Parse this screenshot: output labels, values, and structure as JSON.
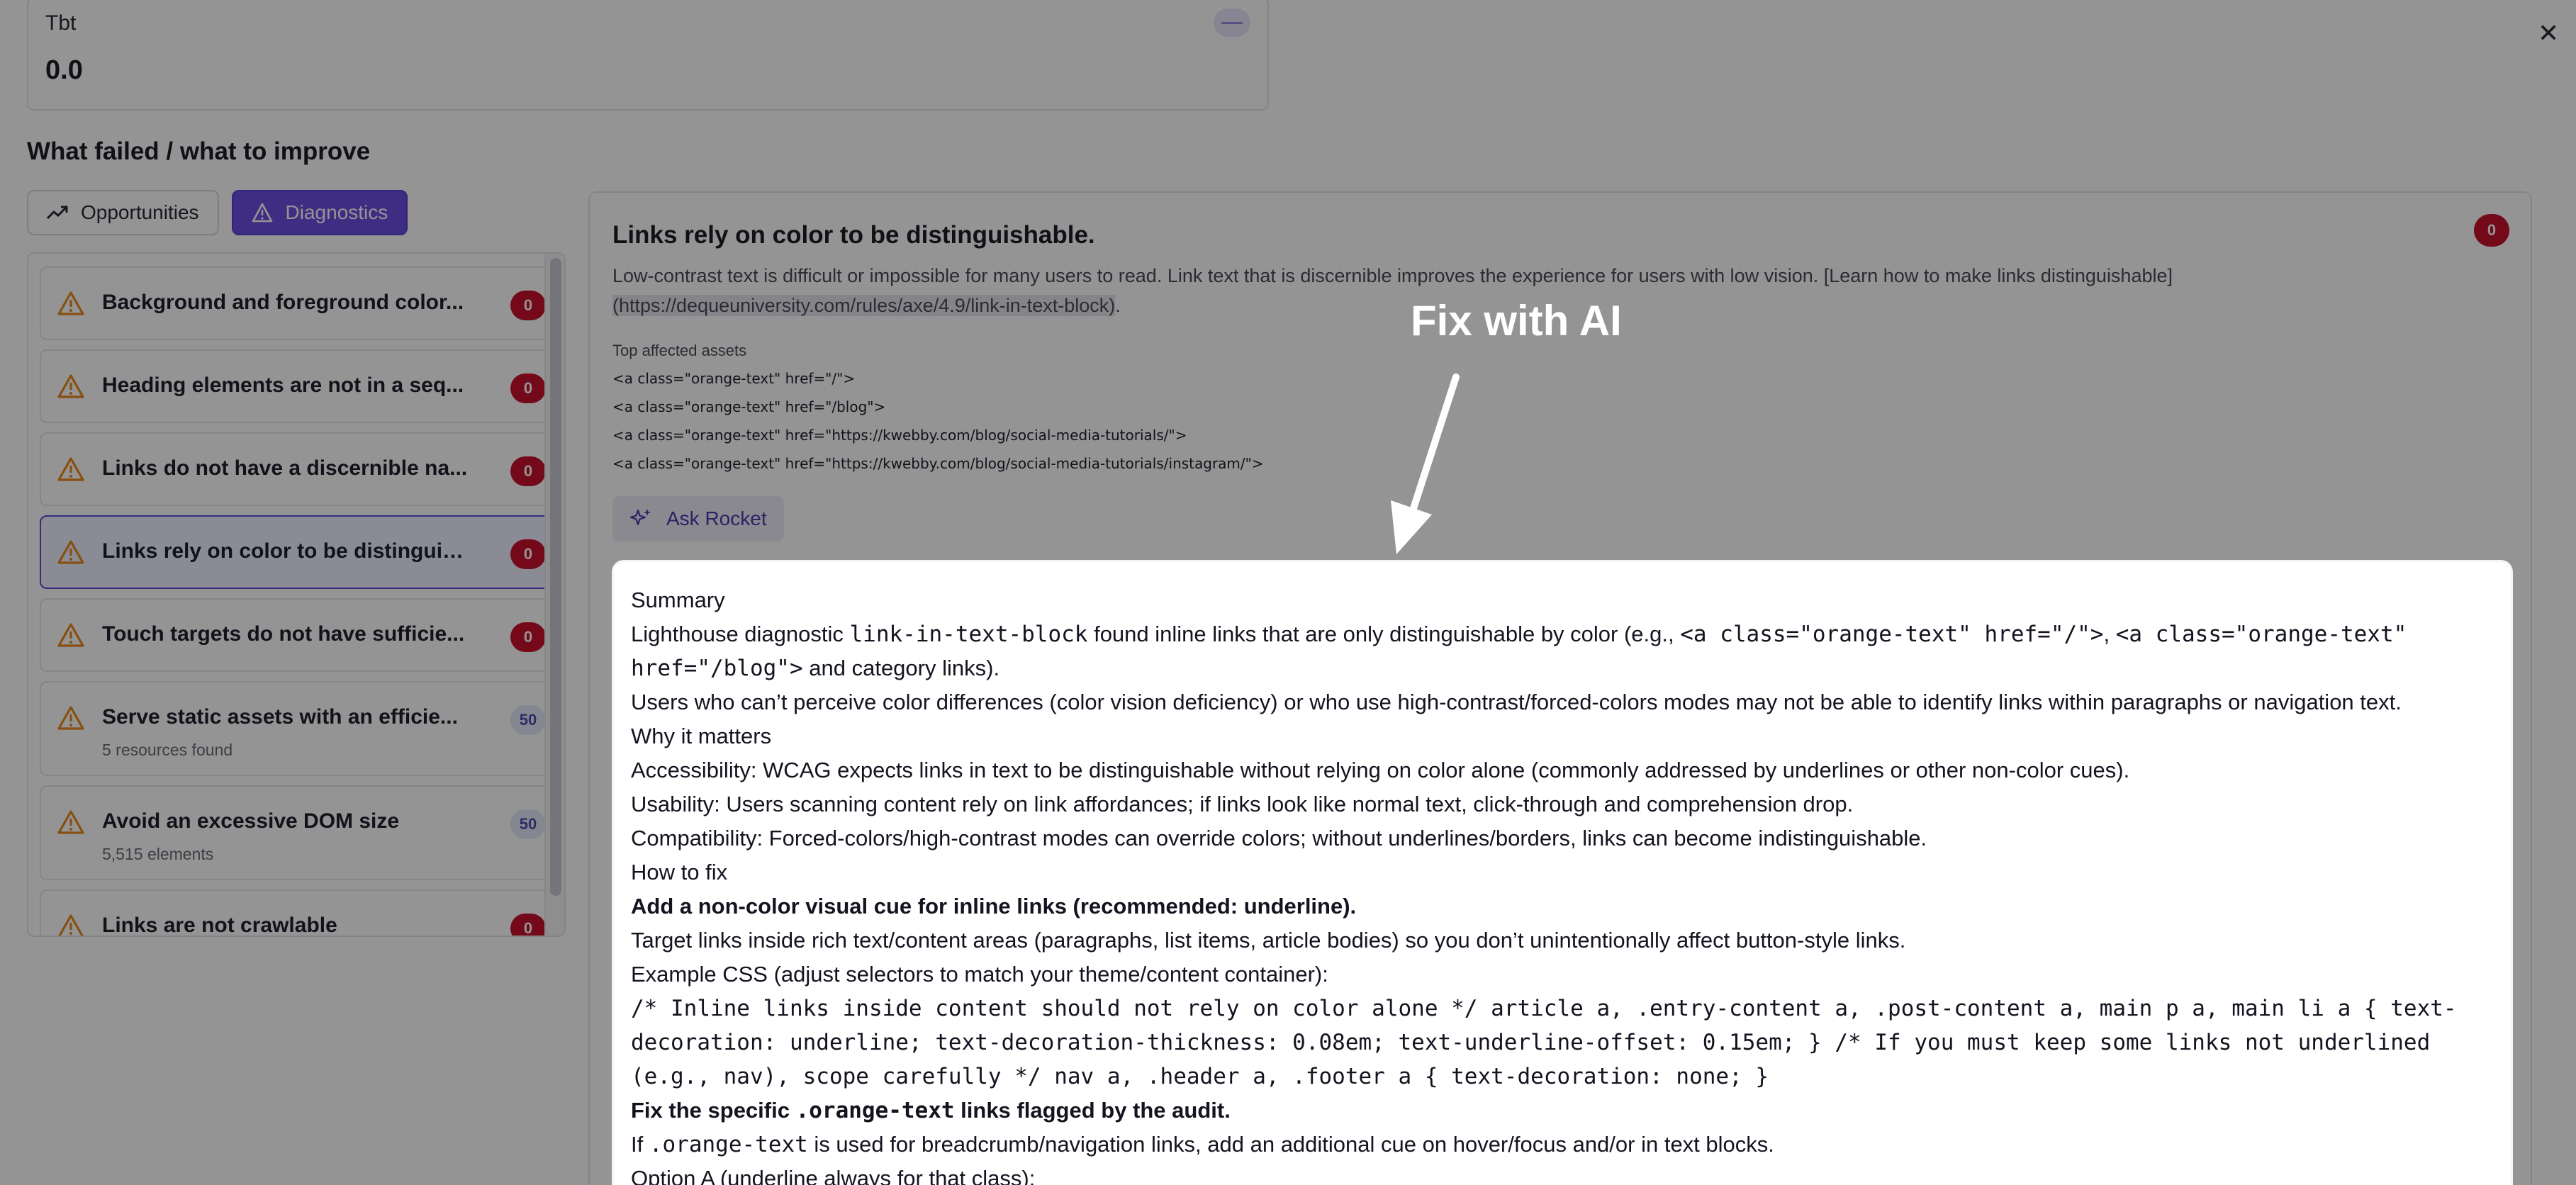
{
  "tbt": {
    "label": "Tbt",
    "value": "0.0",
    "collapse_symbol": "—"
  },
  "section_title": "What failed / what to improve",
  "tabs": [
    {
      "label": "Opportunities",
      "icon": "trend-up-icon",
      "active": false
    },
    {
      "label": "Diagnostics",
      "icon": "warning-icon",
      "active": true
    }
  ],
  "sidebar": {
    "items": [
      {
        "title": "Background and foreground color...",
        "badge": "0",
        "badge_color": "#c8102e",
        "sub": ""
      },
      {
        "title": "Heading elements are not in a seq...",
        "badge": "0",
        "badge_color": "#c8102e",
        "sub": ""
      },
      {
        "title": "Links do not have a discernible na...",
        "badge": "0",
        "badge_color": "#c8102e",
        "sub": ""
      },
      {
        "title": "Links rely on color to be distinguis...",
        "badge": "0",
        "badge_color": "#c8102e",
        "sub": "",
        "selected": true
      },
      {
        "title": "Touch targets do not have sufficie...",
        "badge": "0",
        "badge_color": "#c8102e",
        "sub": ""
      },
      {
        "title": "Serve static assets with an efficie...",
        "badge": "50",
        "badge_color": "#e6e8f8",
        "sub": "5 resources found"
      },
      {
        "title": "Avoid an excessive DOM size",
        "badge": "50",
        "badge_color": "#e6e8f8",
        "sub": "5,515 elements"
      },
      {
        "title": "Links are not crawlable",
        "badge": "0",
        "badge_color": "#c8102e",
        "sub": ""
      }
    ]
  },
  "detail": {
    "title": "Links rely on color to be distinguishable.",
    "badge": "0",
    "desc_text": "Low-contrast text is difficult or impossible for many users to read. Link text that is discernible improves the experience for users with low vision. [Learn how to make links distinguishable]",
    "desc_url": "(https://dequeuniversity.com/rules/axe/4.9/link-in-text-block)",
    "desc_end": ".",
    "assets_label": "Top affected assets",
    "assets": [
      "<a class=\"orange-text\" href=\"/\">",
      "<a class=\"orange-text\" href=\"/blog\">",
      "<a class=\"orange-text\" href=\"https://kwebby.com/blog/social-media-tutorials/\">",
      "<a class=\"orange-text\" href=\"https://kwebby.com/blog/social-media-tutorials/instagram/\">"
    ],
    "ask_button": "Ask Rocket"
  },
  "overlay": {
    "callout": "Fix with AI"
  },
  "ai_response": {
    "summary_heading": "Summary",
    "summary_p1_a": "Lighthouse diagnostic ",
    "summary_p1_code1": "link-in-text-block",
    "summary_p1_b": " found inline links that are only distinguishable by color (e.g., ",
    "summary_p1_code2": "<a class=\"orange-text\" href=\"/\">",
    "summary_p1_c": ", ",
    "summary_p1_code3": "<a class=\"orange-text\" href=\"/blog\">",
    "summary_p1_d": " and category links).",
    "summary_p2": "Users who can’t perceive color differences (color vision deficiency) or who use high-contrast/forced-colors modes may not be able to identify links within paragraphs or navigation text.",
    "why_heading": "Why it matters",
    "why_1": "Accessibility: WCAG expects links in text to be distinguishable without relying on color alone (commonly addressed by underlines or other non-color cues).",
    "why_2": "Usability: Users scanning content rely on link affordances; if links look like normal text, click-through and comprehension drop.",
    "why_3": "Compatibility: Forced-colors/high-contrast modes can override colors; without underlines/borders, links can become indistinguishable.",
    "how_heading": "How to fix",
    "how_bold_1": "Add a non-color visual cue for inline links (recommended: underline).",
    "how_1": "Target links inside rich text/content areas (paragraphs, list items, article bodies) so you don’t unintentionally affect button-style links.",
    "how_2": "Example CSS (adjust selectors to match your theme/content container):",
    "code": "/* Inline links inside content should not rely on color alone */ article a, .entry-content a, .post-content a, main p a, main li a { text-decoration: underline; text-decoration-thickness: 0.08em; text-underline-offset: 0.15em; } /* If you must keep some links not underlined (e.g., nav), scope carefully */ nav a, .header a, .footer a { text-decoration: none; }",
    "fix_bold_a": "Fix the specific ",
    "fix_bold_code": ".orange-text",
    "fix_bold_b": " links flagged by the audit.",
    "fix_p_a": "If ",
    "fix_p_code": ".orange-text",
    "fix_p_b": " is used for breadcrumb/navigation links, add an additional cue on hover/focus and/or in text blocks.",
    "option_a": "Option A (underline always for that class):"
  },
  "colors": {
    "accent": "#6c4fe0",
    "danger": "#c8102e",
    "overlay": "rgba(0,0,0,0.42)"
  }
}
